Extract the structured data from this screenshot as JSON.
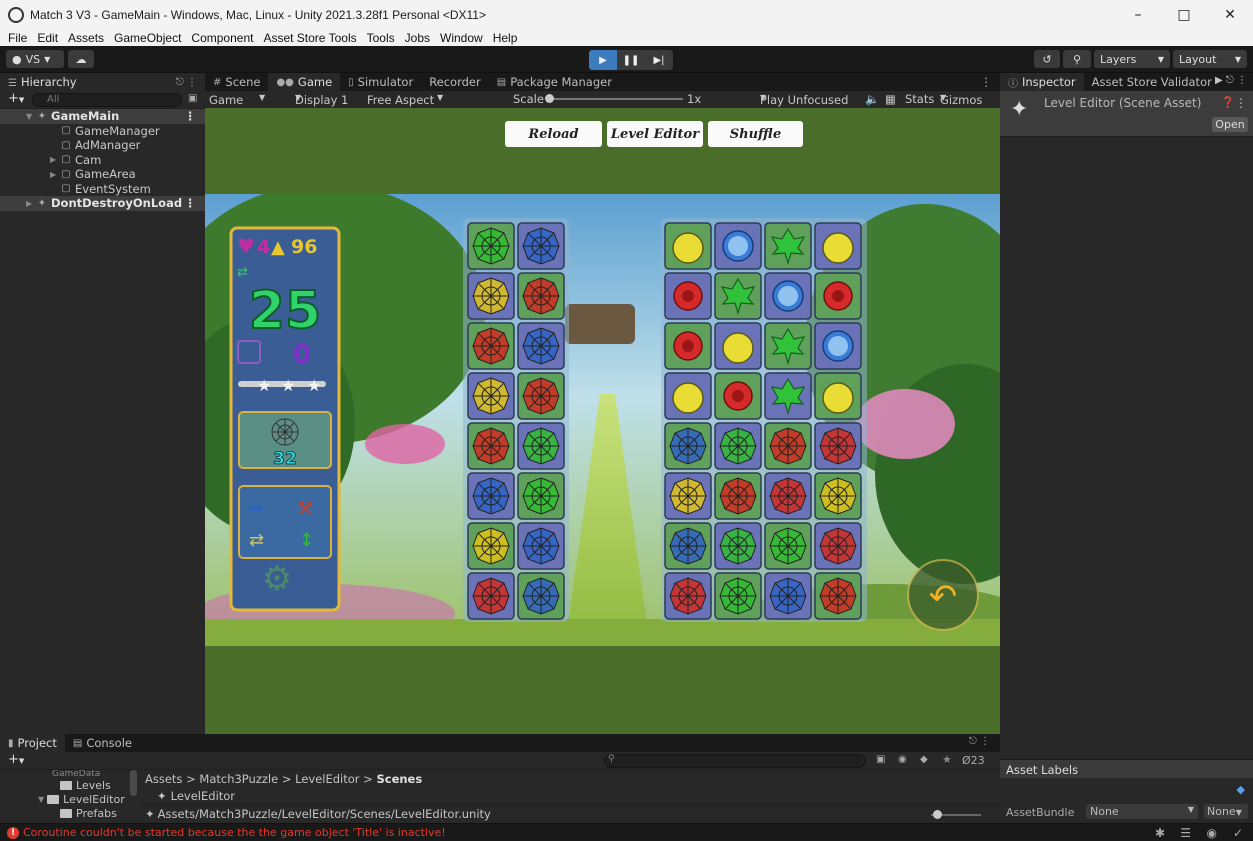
{
  "window": {
    "title": "Match 3 V3 - GameMain - Windows, Mac, Linux - Unity 2021.3.28f1 Personal <DX11>",
    "minimize": "–",
    "maximize": "□",
    "close": "✕"
  },
  "menu": [
    "File",
    "Edit",
    "Assets",
    "GameObject",
    "Component",
    "Asset Store Tools",
    "Tools",
    "Jobs",
    "Window",
    "Help"
  ],
  "toolbar": {
    "account": "VS",
    "layers": "Layers",
    "layout": "Layout"
  },
  "hierarchy": {
    "tab": "Hierarchy",
    "search_placeholder": "All",
    "items": [
      {
        "label": "GameMain",
        "type": "scene"
      },
      {
        "label": "GameManager",
        "type": "object"
      },
      {
        "label": "AdManager",
        "type": "object"
      },
      {
        "label": "Cam",
        "type": "object"
      },
      {
        "label": "GameArea",
        "type": "object"
      },
      {
        "label": "EventSystem",
        "type": "object"
      },
      {
        "label": "DontDestroyOnLoad",
        "type": "scene"
      }
    ]
  },
  "center_tabs": [
    "Scene",
    "Game",
    "Simulator",
    "Recorder",
    "Package Manager"
  ],
  "game_toolbar": {
    "mode": "Game",
    "display": "Display 1",
    "aspect": "Free Aspect",
    "scale_label": "Scale",
    "scale_value": "1x",
    "play_mode": "Play Unfocused",
    "stats": "Stats",
    "gizmos": "Gizmos"
  },
  "game": {
    "buttons": [
      "Reload",
      "Level Editor",
      "Shuffle"
    ],
    "hud": {
      "lives": "4",
      "coins": "96",
      "moves": "25",
      "goals": "0",
      "target_count": "32"
    },
    "colors": {
      "web_red": "#d32a1e",
      "web_green": "#2fbe2f",
      "web_blue": "#2e63c6",
      "web_yellow": "#e2c418",
      "tile_green": "#5fa05a",
      "tile_purple": "#6a73b8"
    },
    "left_board": [
      [
        "web_green",
        "web_blue"
      ],
      [
        "web_yellow",
        "web_red"
      ],
      [
        "web_red",
        "web_blue"
      ],
      [
        "web_yellow",
        "web_red"
      ],
      [
        "web_red",
        "web_green"
      ],
      [
        "web_blue",
        "web_green"
      ],
      [
        "web_yellow",
        "web_blue"
      ],
      [
        "web_red",
        "web_blue"
      ]
    ],
    "right_board": [
      [
        "apple",
        "globe",
        "leaf",
        "apple"
      ],
      [
        "rose",
        "leaf",
        "globe",
        "rose"
      ],
      [
        "rose",
        "apple",
        "leaf",
        "globe"
      ],
      [
        "apple",
        "rose",
        "leaf",
        "apple"
      ],
      [
        "web_blue",
        "web_green",
        "web_red",
        "web_red"
      ],
      [
        "web_yellow",
        "web_red",
        "web_red",
        "web_yellow"
      ],
      [
        "web_blue",
        "web_green",
        "web_green",
        "web_red"
      ],
      [
        "web_red",
        "web_green",
        "web_blue",
        "web_red"
      ]
    ]
  },
  "inspector": {
    "tabs": [
      "Inspector",
      "Asset Store Validator"
    ],
    "title": "Level Editor (Scene Asset)",
    "open": "Open",
    "asset_labels": "Asset Labels",
    "asset_bundle": "AssetBundle",
    "bundle_value": "None",
    "variant_value": "None"
  },
  "project": {
    "tabs": [
      "Project",
      "Console"
    ],
    "hidden_count": "23",
    "tree": [
      "GameData",
      "Levels",
      "LevelEditor",
      "Prefabs"
    ],
    "breadcrumb": [
      "Assets",
      "Match3Puzzle",
      "LevelEditor",
      "Scenes"
    ],
    "selected_asset": "LevelEditor",
    "path": "Assets/Match3Puzzle/LevelEditor/Scenes/LevelEditor.unity"
  },
  "status": {
    "message": "Coroutine couldn't be started because the the game object 'Title' is inactive!"
  }
}
